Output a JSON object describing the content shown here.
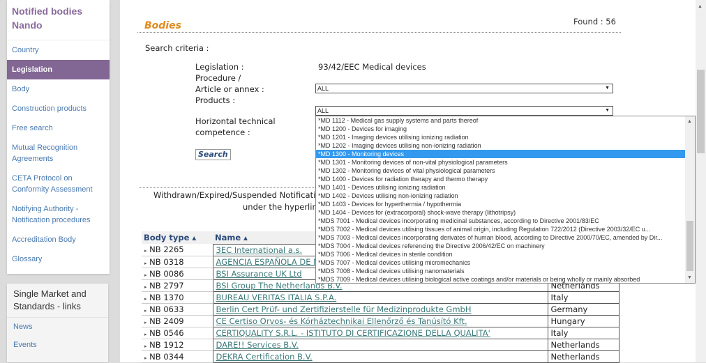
{
  "sidebar": {
    "title": "Notified bodies Nando",
    "items": [
      {
        "label": "Country"
      },
      {
        "label": "Legislation",
        "active": true
      },
      {
        "label": "Body"
      },
      {
        "label": "Construction products"
      },
      {
        "label": "Free search"
      },
      {
        "label": "Mutual Recognition Agreements"
      },
      {
        "label": "CETA Protocol on Conformity Assessment"
      },
      {
        "label": "Notifying Authority - Notification procedures"
      },
      {
        "label": "Accreditation Body"
      },
      {
        "label": "Glossary"
      }
    ]
  },
  "links": {
    "title": "Single Market and Standards - links",
    "items": [
      "News",
      "Events"
    ]
  },
  "main": {
    "title": "Bodies",
    "found": "Found : 56",
    "search_criteria": "Search criteria :",
    "legislation_label": "Legislation :",
    "legislation_value": "93/42/EEC Medical devices",
    "procedure_label_1": "Procedure /",
    "procedure_label_2": "Article or annex :",
    "procedure_value": "ALL",
    "products_label": "Products :",
    "products_value": "ALL",
    "htc_label_1": "Horizontal technical",
    "htc_label_2": "competence :",
    "search_button": "Search",
    "withdrawn_1": "Withdrawn/Expired/Suspended Notificatio",
    "withdrawn_2": "under the hyperlin"
  },
  "table": {
    "headers": [
      "Body type ▴",
      "Name ▴"
    ],
    "rows": [
      [
        "NB 2265",
        "3EC International a.s.",
        ""
      ],
      [
        "NB 0318",
        "AGENCIA ESPAÑOLA DE M",
        ""
      ],
      [
        "NB 0086",
        "BSI Assurance UK Ltd",
        ""
      ],
      [
        "NB 2797",
        "BSI Group The Netherlands B.V.",
        "Netherlands"
      ],
      [
        "NB 1370",
        "BUREAU VERITAS ITALIA S.P.A.",
        "Italy"
      ],
      [
        "NB 0633",
        "Berlin Cert Prüf- und Zertifizierstelle für Medizinprodukte GmbH",
        "Germany"
      ],
      [
        "NB 2409",
        "CE Certiso Orvos- és Kórháztechnikai Ellenőrző és Tanúsító Kft.",
        "Hungary"
      ],
      [
        "NB 0546",
        "CERTIQUALITY S.R.L. - ISTITUTO DI CERTIFICAZIONE DELLA QUALITA'",
        "Italy"
      ],
      [
        "NB 1912",
        "DARE!! Services B.V.",
        "Netherlands"
      ],
      [
        "NB 0344",
        "DEKRA Certification B.V.",
        "Netherlands"
      ]
    ]
  },
  "dropdown": {
    "selected": "*MD 1300 - Monitoring devices",
    "options": [
      "*MD 1112 - Medical gas supply systems and parts thereof",
      "*MD 1200 - Devices for imaging",
      "*MD 1201 - Imaging devices utilising ionizing radiation",
      "*MD 1202 - Imaging devices utilising non-ionizing radiation",
      "*MD 1300 - Monitoring devices",
      "*MD 1301 - Monitoring devices of non-vital physiological parameters",
      "*MD 1302 - Monitoring devices of vital physiological parameters",
      "*MD 1400 - Devices for radiation therapy and thermo therapy",
      "*MD 1401 - Devices utilising ionizing radiation",
      "*MD 1402 - Devices utilising non-ionizing radiation",
      "*MD 1403 - Devices for hyperthermia / hypothermia",
      "*MD 1404 - Devices for (extracorporal) shock-wave therapy (lithotripsy)",
      "*MDS 7001 - Medical devices incorporating medicinal substances, according to Directive 2001/83/EC",
      "*MDS 7002 - Medical devices utilising tissues of animal origin, including Regulation 722/2012 (Directive 2003/32/EC u...",
      "*MDS 7003 - Medical devices incorporating derivates of human blood, according to Directive 2000/70/EC, amended by Dir...",
      "*MDS 7004 - Medical devices referencing the Directive 2006/42/EC on machinery",
      "*MDS 7006 - Medical devices in sterile condition",
      "*MDS 7007 - Medical devices utilising micromechanics",
      "*MDS 7008 - Medical devices utilising nanomaterials",
      "*MDS 7009 - Medical devices utilising biological active coatings and/or materials or being wholly or mainly absorbed"
    ]
  },
  "colors": {
    "accent": "#826694",
    "title": "#e08a1e",
    "highlight": "#3399ee"
  }
}
